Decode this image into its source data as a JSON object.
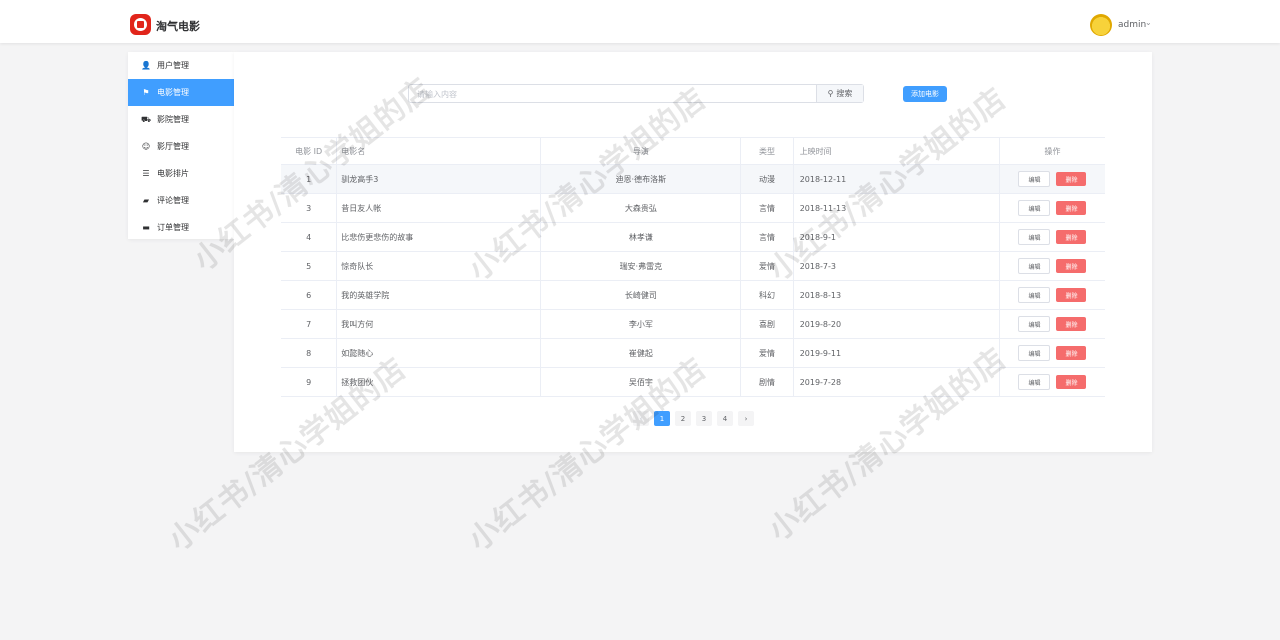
{
  "header": {
    "brand": "淘气电影",
    "username": "admin",
    "caret": "⌄"
  },
  "sidebar": {
    "items": [
      {
        "label": "用户管理",
        "icon": "👤"
      },
      {
        "label": "电影管理",
        "icon": "⚑",
        "active": true
      },
      {
        "label": "影院管理",
        "icon": "⛟"
      },
      {
        "label": "影厅管理",
        "icon": "☺"
      },
      {
        "label": "电影排片",
        "icon": "☰"
      },
      {
        "label": "评论管理",
        "icon": "▰"
      },
      {
        "label": "订单管理",
        "icon": "▬"
      }
    ]
  },
  "search": {
    "placeholder": "请输入内容",
    "button_label": "搜索",
    "button_icon": "⚲"
  },
  "toolbar": {
    "add_label": "添加电影"
  },
  "table": {
    "headers": [
      "电影 ID",
      "电影名",
      "导演",
      "类型",
      "上映时间",
      "操作"
    ],
    "rows": [
      {
        "id": "1",
        "name": "驯龙高手3",
        "director": "迪恩·德布洛斯",
        "type": "动漫",
        "date": "2018-12-11"
      },
      {
        "id": "3",
        "name": "昔日友人帐",
        "director": "大森贵弘",
        "type": "言情",
        "date": "2018-11-13"
      },
      {
        "id": "4",
        "name": "比悲伤更悲伤的故事",
        "director": "林孝谦",
        "type": "言情",
        "date": "2018-9-1"
      },
      {
        "id": "5",
        "name": "惊奇队长",
        "director": "瑞安·弗雷克",
        "type": "爱情",
        "date": "2018-7-3"
      },
      {
        "id": "6",
        "name": "我的英雄学院",
        "director": "长崎健司",
        "type": "科幻",
        "date": "2018-8-13"
      },
      {
        "id": "7",
        "name": "我叫方何",
        "director": "李小军",
        "type": "喜剧",
        "date": "2019-8-20"
      },
      {
        "id": "8",
        "name": "如懿随心",
        "director": "崔健起",
        "type": "爱情",
        "date": "2019-9-11"
      },
      {
        "id": "9",
        "name": "拯救团伙",
        "director": "吴佰宇",
        "type": "剧情",
        "date": "2019-7-28"
      }
    ],
    "edit_label": "编辑",
    "delete_label": "删除"
  },
  "pagination": {
    "prev": "‹",
    "next": "›",
    "pages": [
      "1",
      "2",
      "3",
      "4"
    ],
    "current": "1"
  },
  "watermark": "小红书/清心学姐的店",
  "colors": {
    "primary": "#409eff",
    "danger": "#f56c6c",
    "logo": "#e1251b"
  }
}
